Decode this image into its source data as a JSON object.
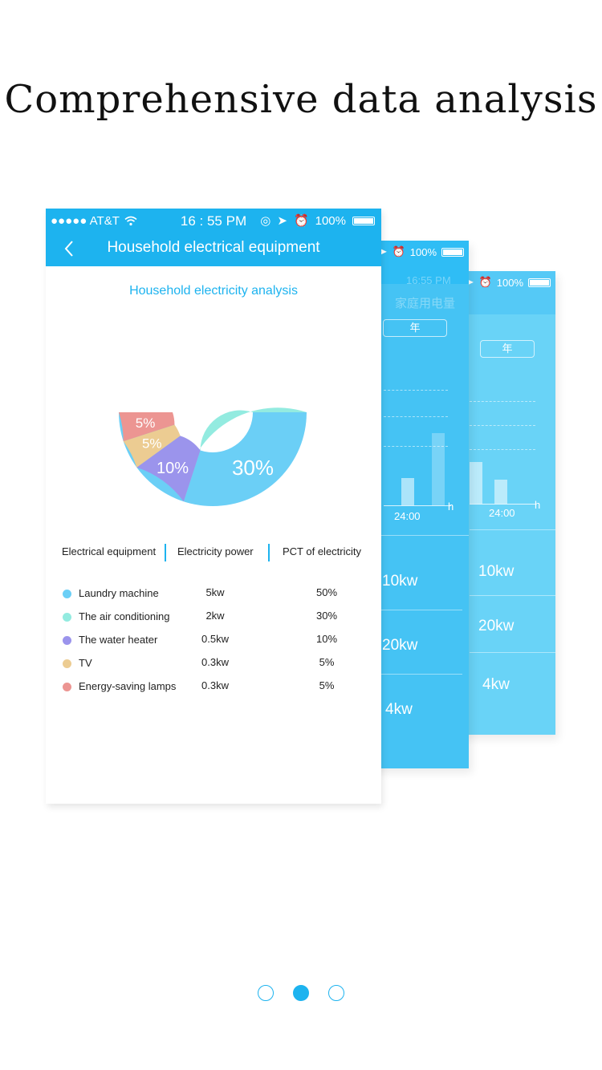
{
  "headline": "Comprehensive data analysis",
  "back_card_right": {
    "battery_text": "100%",
    "year_tab": "年",
    "time_label": "24:00",
    "axis_unit": "h",
    "kw_values": [
      "10kw",
      "20kw",
      "4kw"
    ]
  },
  "back_card_middle": {
    "battery_text": "100%",
    "faded_time": "16:55 PM",
    "faded_title": "家庭用电量",
    "year_tab": "年",
    "time_label": "24:00",
    "axis_unit": "h",
    "kw_values": [
      "10kw",
      "20kw",
      "4kw"
    ]
  },
  "front_card": {
    "status": {
      "carrier": "●●●●● AT&T",
      "time": "16 : 55 PM",
      "battery": "100%"
    },
    "nav_title": "Household electrical equipment",
    "analysis_title": "Household electricity analysis",
    "chart_data": {
      "type": "pie",
      "donut": true,
      "labels": [
        "Laundry machine",
        "The air conditioning",
        "The water heater",
        "TV",
        "Energy-saving lamps"
      ],
      "values": [
        50,
        30,
        10,
        5,
        5
      ],
      "value_labels": [
        "50%",
        "30%",
        "10%",
        "5%",
        "5%"
      ],
      "colors": [
        "#6bcff6",
        "#93ebe0",
        "#9b94ec",
        "#eccc92",
        "#ec9592"
      ]
    },
    "table": {
      "headers": [
        "Electrical equipment",
        "Electricity power",
        "PCT of electricity"
      ],
      "rows": [
        {
          "name": "Laundry machine",
          "power": "5kw",
          "pct": "50%",
          "color": "#6bcff6"
        },
        {
          "name": "The air conditioning",
          "power": "2kw",
          "pct": "30%",
          "color": "#93ebe0"
        },
        {
          "name": "The water heater",
          "power": "0.5kw",
          "pct": "10%",
          "color": "#9b94ec"
        },
        {
          "name": "TV",
          "power": "0.3kw",
          "pct": "5%",
          "color": "#eccc92"
        },
        {
          "name": "Energy-saving lamps",
          "power": "0.3kw",
          "pct": "5%",
          "color": "#ec9592"
        }
      ]
    }
  },
  "pager": {
    "count": 3,
    "active_index": 1
  }
}
